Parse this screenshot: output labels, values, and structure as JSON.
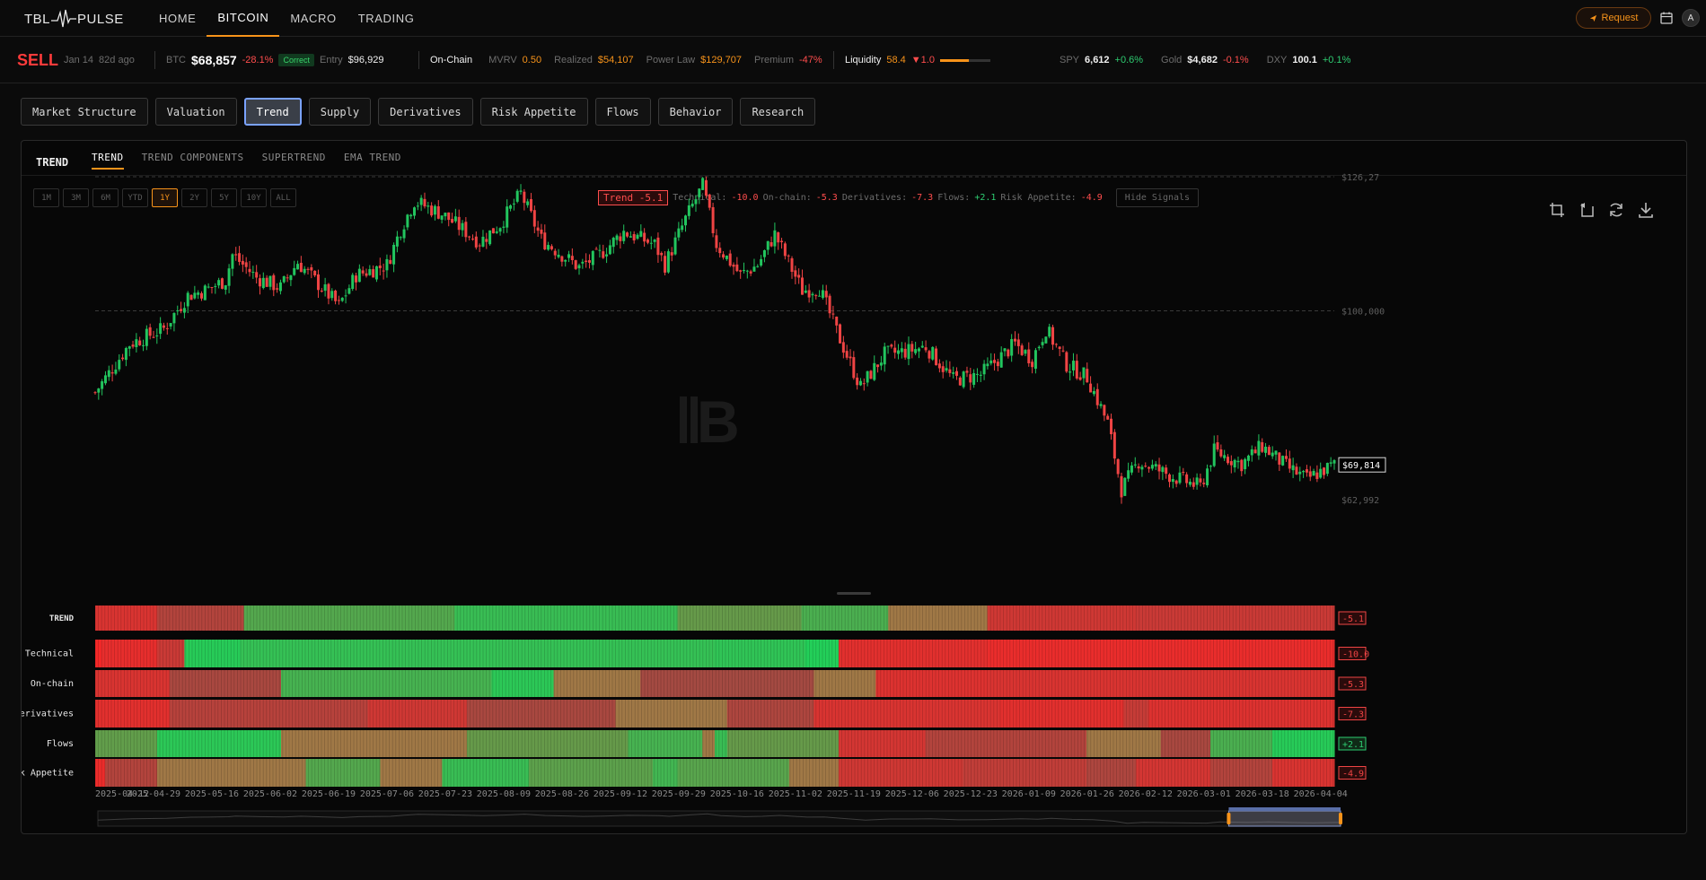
{
  "brand": {
    "left": "TBL",
    "right": "PULSE"
  },
  "nav": {
    "items": [
      {
        "label": "HOME",
        "active": false
      },
      {
        "label": "BITCOIN",
        "active": true
      },
      {
        "label": "MACRO",
        "active": false
      },
      {
        "label": "TRADING",
        "active": false
      }
    ],
    "request_label": "Request",
    "avatar_initial": "A"
  },
  "ticker": {
    "signal": "SELL",
    "signal_date": "Jan 14",
    "signal_age": "82d ago",
    "btc_label": "BTC",
    "btc_price": "$68,857",
    "btc_change": "-28.1%",
    "correct_badge": "Correct",
    "entry_label": "Entry",
    "entry_price": "$96,929",
    "onchain_label": "On-Chain",
    "mvrv_label": "MVRV",
    "mvrv_value": "0.50",
    "realized_label": "Realized",
    "realized_value": "$54,107",
    "powerlaw_label": "Power Law",
    "powerlaw_value": "$129,707",
    "premium_label": "Premium",
    "premium_value": "-47%",
    "liquidity_label": "Liquidity",
    "liquidity_value": "58.4",
    "liquidity_delta": "▼1.0",
    "liquidity_level": 0.58,
    "spy_label": "SPY",
    "spy_value": "6,612",
    "spy_change": "+0.6%",
    "gold_label": "Gold",
    "gold_value": "$4,682",
    "gold_change": "-0.1%",
    "dxy_label": "DXY",
    "dxy_value": "100.1",
    "dxy_change": "+0.1%"
  },
  "categories": [
    {
      "label": "Market Structure",
      "active": false
    },
    {
      "label": "Valuation",
      "active": false
    },
    {
      "label": "Trend",
      "active": true
    },
    {
      "label": "Supply",
      "active": false
    },
    {
      "label": "Derivatives",
      "active": false
    },
    {
      "label": "Risk Appetite",
      "active": false
    },
    {
      "label": "Flows",
      "active": false
    },
    {
      "label": "Behavior",
      "active": false
    },
    {
      "label": "Research",
      "active": false
    }
  ],
  "panel": {
    "title": "TREND",
    "tabs": [
      {
        "label": "TREND",
        "active": true
      },
      {
        "label": "TREND COMPONENTS",
        "active": false
      },
      {
        "label": "SUPERTREND",
        "active": false
      },
      {
        "label": "EMA TREND",
        "active": false
      }
    ],
    "ranges": [
      {
        "label": "1M",
        "active": false
      },
      {
        "label": "3M",
        "active": false
      },
      {
        "label": "6M",
        "active": false
      },
      {
        "label": "YTD",
        "active": false
      },
      {
        "label": "1Y",
        "active": true
      },
      {
        "label": "2Y",
        "active": false
      },
      {
        "label": "5Y",
        "active": false
      },
      {
        "label": "10Y",
        "active": false
      },
      {
        "label": "ALL",
        "active": false
      }
    ],
    "signal_summary": {
      "trend_badge": "Trend -5.1",
      "technical_label": "Technical:",
      "technical_value": "-10.0",
      "onchain_label": "On-chain:",
      "onchain_value": "-5.3",
      "derivatives_label": "Derivatives:",
      "derivatives_value": "-7.3",
      "flows_label": "Flows:",
      "flows_value": "+2.1",
      "risk_label": "Risk Appetite:",
      "risk_value": "-4.9"
    },
    "hide_signals_label": "Hide Signals"
  },
  "chart_data": {
    "type": "candlestick",
    "series_name": "BTC",
    "ylim": [
      62992,
      126272
    ],
    "y_ticks": [
      {
        "value": 126272,
        "label": "$126,27"
      },
      {
        "value": 100000,
        "label": "$100,000"
      },
      {
        "value": 62992,
        "label": "$62,992"
      }
    ],
    "last_price": {
      "value": 69814,
      "label": "$69,814"
    },
    "x_ticks": [
      "2025-04-12",
      "2025-04-29",
      "2025-05-16",
      "2025-06-02",
      "2025-06-19",
      "2025-07-06",
      "2025-07-23",
      "2025-08-09",
      "2025-08-26",
      "2025-09-12",
      "2025-09-29",
      "2025-10-16",
      "2025-11-02",
      "2025-11-19",
      "2025-12-06",
      "2025-12-23",
      "2026-01-09",
      "2026-01-26",
      "2026-02-12",
      "2026-03-01",
      "2026-03-18",
      "2026-04-04"
    ],
    "close_path": [
      [
        "2025-04-12",
        84000
      ],
      [
        "2025-04-22",
        93500
      ],
      [
        "2025-05-02",
        96500
      ],
      [
        "2025-05-09",
        103000
      ],
      [
        "2025-05-14",
        104000
      ],
      [
        "2025-05-20",
        106000
      ],
      [
        "2025-05-22",
        111000
      ],
      [
        "2025-05-29",
        106500
      ],
      [
        "2025-06-05",
        104500
      ],
      [
        "2025-06-10",
        109500
      ],
      [
        "2025-06-22",
        101000
      ],
      [
        "2025-06-27",
        107000
      ],
      [
        "2025-07-06",
        109000
      ],
      [
        "2025-07-10",
        116000
      ],
      [
        "2025-07-14",
        121500
      ],
      [
        "2025-07-22",
        119000
      ],
      [
        "2025-08-02",
        113500
      ],
      [
        "2025-08-08",
        117000
      ],
      [
        "2025-08-14",
        123000
      ],
      [
        "2025-08-20",
        114000
      ],
      [
        "2025-08-31",
        108500
      ],
      [
        "2025-09-06",
        111000
      ],
      [
        "2025-09-13",
        115500
      ],
      [
        "2025-09-22",
        113000
      ],
      [
        "2025-09-25",
        109000
      ],
      [
        "2025-10-01",
        118000
      ],
      [
        "2025-10-06",
        124500
      ],
      [
        "2025-10-10",
        113000
      ],
      [
        "2025-10-17",
        107000
      ],
      [
        "2025-10-22",
        109000
      ],
      [
        "2025-10-27",
        115000
      ],
      [
        "2025-11-04",
        104000
      ],
      [
        "2025-11-09",
        104500
      ],
      [
        "2025-11-14",
        96000
      ],
      [
        "2025-11-21",
        85000
      ],
      [
        "2025-11-28",
        91500
      ],
      [
        "2025-12-04",
        92000
      ],
      [
        "2025-12-10",
        93000
      ],
      [
        "2025-12-18",
        86500
      ],
      [
        "2025-12-26",
        87500
      ],
      [
        "2026-01-05",
        93500
      ],
      [
        "2026-01-10",
        90500
      ],
      [
        "2026-01-14",
        96500
      ],
      [
        "2026-01-20",
        89500
      ],
      [
        "2026-01-26",
        87000
      ],
      [
        "2026-02-01",
        78000
      ],
      [
        "2026-02-05",
        65000
      ],
      [
        "2026-02-10",
        70500
      ],
      [
        "2026-02-20",
        67500
      ],
      [
        "2026-02-28",
        65500
      ],
      [
        "2026-03-04",
        72500
      ],
      [
        "2026-03-12",
        70000
      ],
      [
        "2026-03-18",
        73500
      ],
      [
        "2026-03-25",
        69500
      ],
      [
        "2026-03-31",
        67000
      ],
      [
        "2026-04-04",
        68500
      ],
      [
        "2026-04-08",
        69814
      ]
    ],
    "heatmap_rows": [
      {
        "label": "TREND",
        "value": "-5.1",
        "segments": [
          [
            0,
            0.05,
            -0.7
          ],
          [
            0.05,
            0.12,
            -0.3
          ],
          [
            0.12,
            0.29,
            0.4
          ],
          [
            0.29,
            0.47,
            0.7
          ],
          [
            0.47,
            0.57,
            0.2
          ],
          [
            0.57,
            0.64,
            0.5
          ],
          [
            0.64,
            0.72,
            -0.1
          ],
          [
            0.72,
            0.84,
            -0.6
          ],
          [
            0.84,
            1.0,
            -0.55
          ]
        ]
      },
      {
        "label": "Technical",
        "value": "-10.0",
        "segments": [
          [
            0,
            0.005,
            -1
          ],
          [
            0.005,
            0.05,
            -0.85
          ],
          [
            0.05,
            0.072,
            -0.55
          ],
          [
            0.072,
            0.117,
            0.9
          ],
          [
            0.117,
            0.5,
            0.75
          ],
          [
            0.5,
            0.573,
            0.8
          ],
          [
            0.573,
            0.6,
            0.95
          ],
          [
            0.6,
            0.72,
            -0.8
          ],
          [
            0.72,
            1.0,
            -0.88
          ]
        ]
      },
      {
        "label": "On-chain",
        "value": "-5.3",
        "segments": [
          [
            0,
            0.06,
            -0.7
          ],
          [
            0.06,
            0.15,
            -0.2
          ],
          [
            0.15,
            0.32,
            0.55
          ],
          [
            0.32,
            0.37,
            0.85
          ],
          [
            0.37,
            0.44,
            0.0
          ],
          [
            0.44,
            0.58,
            -0.15
          ],
          [
            0.58,
            0.63,
            -0.05
          ],
          [
            0.63,
            0.72,
            -0.75
          ],
          [
            0.72,
            1.0,
            -0.7
          ]
        ]
      },
      {
        "label": "Derivatives",
        "value": "-7.3",
        "segments": [
          [
            0,
            0.06,
            -0.8
          ],
          [
            0.06,
            0.22,
            -0.35
          ],
          [
            0.22,
            0.3,
            -0.6
          ],
          [
            0.3,
            0.42,
            -0.2
          ],
          [
            0.42,
            0.51,
            -0.1
          ],
          [
            0.51,
            0.58,
            -0.25
          ],
          [
            0.58,
            0.73,
            -0.7
          ],
          [
            0.73,
            0.83,
            -0.8
          ],
          [
            0.83,
            0.85,
            -0.5
          ],
          [
            0.85,
            1.0,
            -0.75
          ]
        ]
      },
      {
        "label": "Flows",
        "value": "+2.1",
        "segments": [
          [
            0,
            0.05,
            0.25
          ],
          [
            0.05,
            0.15,
            0.85
          ],
          [
            0.15,
            0.3,
            0.05
          ],
          [
            0.3,
            0.43,
            0.2
          ],
          [
            0.43,
            0.49,
            0.55
          ],
          [
            0.49,
            0.5,
            0.1
          ],
          [
            0.5,
            0.51,
            0.7
          ],
          [
            0.51,
            0.6,
            0.2
          ],
          [
            0.6,
            0.67,
            -0.65
          ],
          [
            0.67,
            0.8,
            -0.3
          ],
          [
            0.8,
            0.86,
            0.1
          ],
          [
            0.86,
            0.9,
            -0.2
          ],
          [
            0.9,
            0.95,
            0.5
          ],
          [
            0.95,
            1.0,
            0.9
          ]
        ]
      },
      {
        "label": "Risk Appetite",
        "value": "-4.9",
        "segments": [
          [
            0,
            0.008,
            -0.9
          ],
          [
            0.008,
            0.05,
            -0.3
          ],
          [
            0.05,
            0.17,
            -0.05
          ],
          [
            0.17,
            0.23,
            0.4
          ],
          [
            0.23,
            0.28,
            0.1
          ],
          [
            0.28,
            0.35,
            0.7
          ],
          [
            0.35,
            0.45,
            0.3
          ],
          [
            0.45,
            0.47,
            0.6
          ],
          [
            0.47,
            0.56,
            0.35
          ],
          [
            0.56,
            0.6,
            -0.1
          ],
          [
            0.6,
            0.7,
            -0.6
          ],
          [
            0.7,
            0.8,
            -0.45
          ],
          [
            0.8,
            0.84,
            -0.25
          ],
          [
            0.84,
            0.9,
            -0.65
          ],
          [
            0.9,
            0.95,
            -0.3
          ],
          [
            0.95,
            1.0,
            -0.7
          ]
        ]
      }
    ],
    "navigator_range": [
      0.91,
      1.0
    ],
    "grid": false
  }
}
